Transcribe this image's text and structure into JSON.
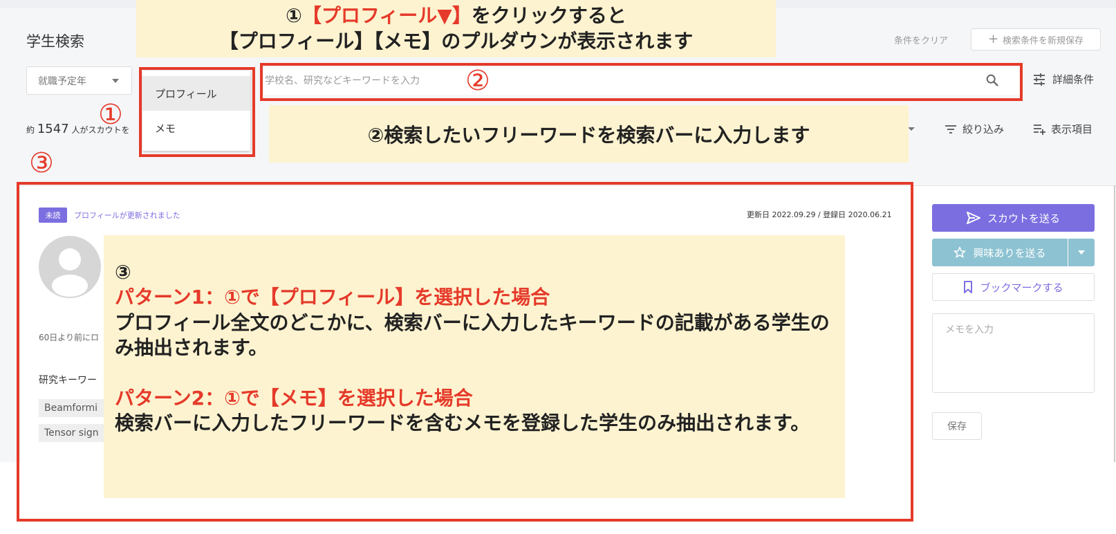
{
  "page": {
    "title": "学生検索"
  },
  "header": {
    "clear_label": "条件をクリア",
    "save_condition_label": "検索条件を新規保存"
  },
  "filters": {
    "graduation_year": "就職予定年",
    "dropdown_options": [
      "プロフィール",
      "メモ"
    ],
    "search_placeholder": "学校名、研究などキーワードを入力",
    "detail_label": "詳細条件"
  },
  "results": {
    "count_prefix": "約",
    "count": "1547",
    "count_suffix": "人がスカウトを",
    "filter_label": "絞り込み",
    "columns_label": "表示項目"
  },
  "card": {
    "badge": "未読",
    "update_note": "プロフィールが更新されました",
    "dates": "更新日 2022.09.29 / 登録日 2020.06.21",
    "last_login": "60日より前にロ",
    "keywords_label": "研究キーワー",
    "keywords": [
      "Beamformi",
      "Tensor sign"
    ]
  },
  "actions": {
    "scout": "スカウトを送る",
    "interest": "興味ありを送る",
    "bookmark": "ブックマークする",
    "memo_placeholder": "メモを入力",
    "save": "保存"
  },
  "annotations": {
    "note1_line1_prefix": "①",
    "note1_line1_highlight": "【プロフィール▼】",
    "note1_line1_suffix": "をクリックすると",
    "note1_line2": "【プロフィール】【メモ】のプルダウンが表示されます",
    "note2": "②検索したいフリーワードを検索バーに入力します",
    "note3_number": "③",
    "note3_pattern1_title": "パターン1：①で【プロフィール】を選択した場合",
    "note3_pattern1_body": "プロフィール全文のどこかに、検索バーに入力したキーワードの記載がある学生のみ抽出されます。",
    "note3_pattern2_title": "パターン2：①で【メモ】を選択した場合",
    "note3_pattern2_body": "検索バーに入力したフリーワードを含むメモを登録した学生のみ抽出されます。",
    "marker1": "①",
    "marker2": "②",
    "marker3": "③"
  },
  "colors": {
    "accent": "#7b6ee0",
    "interest": "#8dc2d2",
    "annotation_red": "#e53a2a",
    "note_bg": "#fdf3d0"
  }
}
